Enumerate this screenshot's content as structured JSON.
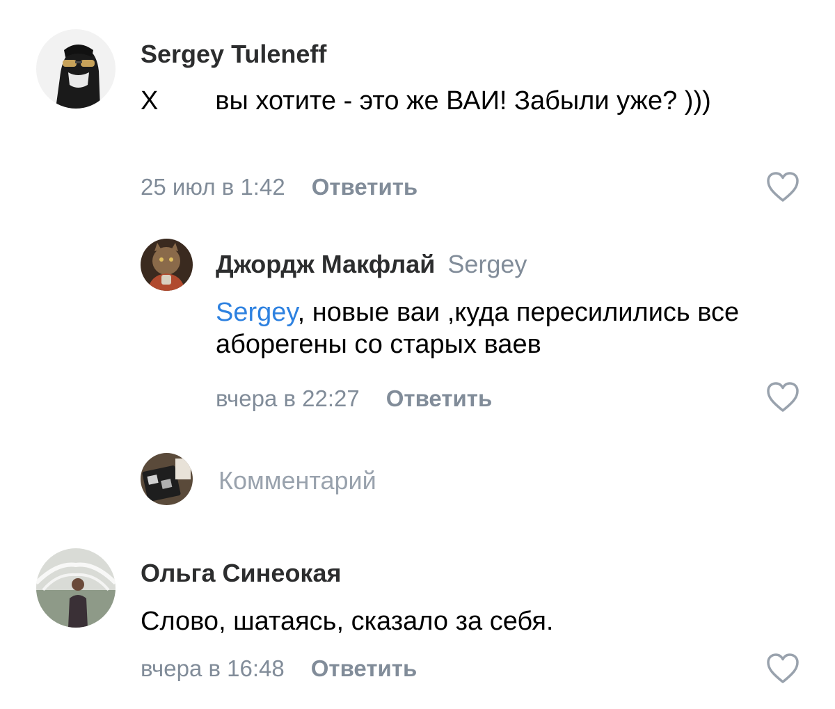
{
  "comments": [
    {
      "author": "Sergey Tuleneff",
      "text_part1": "Х",
      "text_part2": "вы хотите - это же ВАИ! Забыли уже? )))",
      "date": "25 июл в 1:42",
      "reply_label": "Ответить"
    },
    {
      "author": "Джордж Макфлай",
      "reply_to": "Sergey",
      "mention": "Sergey",
      "text": ", новые ваи ,куда пересилились все аборегены со старых ваев",
      "date": "вчера в 22:27",
      "reply_label": "Ответить"
    },
    {
      "author": "Ольга Синеокая",
      "text": "Слово, шатаясь, сказало за себя.",
      "date": "вчера в 16:48",
      "reply_label": "Ответить"
    }
  ],
  "composer": {
    "placeholder": "Комментарий"
  },
  "icons": {
    "like": "heart-outline-icon"
  },
  "colors": {
    "accent": "#2d81e0",
    "secondary_text": "#818c99",
    "author_text": "#2c2d2e"
  }
}
